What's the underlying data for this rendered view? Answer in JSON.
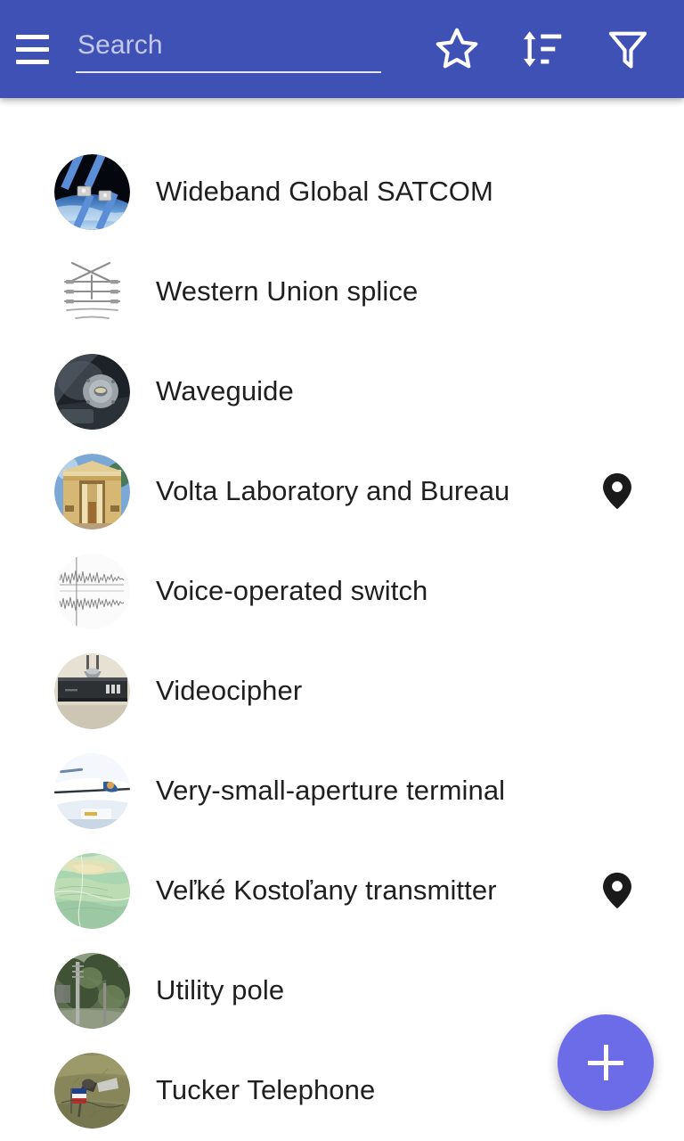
{
  "toolbar": {
    "menu_icon": "hamburger-menu-icon",
    "search": {
      "placeholder": "Search",
      "value": ""
    },
    "actions": [
      {
        "name": "favorites",
        "icon": "star-outline-icon",
        "label": "Favorites"
      },
      {
        "name": "sort",
        "icon": "sort-icon",
        "label": "Sort"
      },
      {
        "name": "filter",
        "icon": "filter-funnel-icon",
        "label": "Filter"
      }
    ],
    "background_color": "#3f51b5"
  },
  "list": {
    "items": [
      {
        "label": "Wideband Global SATCOM",
        "thumb": "satellite-over-earth",
        "has_location": false
      },
      {
        "label": "Western Union splice",
        "thumb": "wire-splice-diagram",
        "has_location": false
      },
      {
        "label": "Waveguide",
        "thumb": "waveguide-flange-photo",
        "has_location": false
      },
      {
        "label": "Volta Laboratory and Bureau",
        "thumb": "neoclassical-building",
        "has_location": true
      },
      {
        "label": "Voice-operated switch",
        "thumb": "audio-waveform",
        "has_location": false
      },
      {
        "label": "Videocipher",
        "thumb": "set-top-box",
        "has_location": false
      },
      {
        "label": "Very-small-aperture terminal",
        "thumb": "white-aircraft-dish",
        "has_location": false
      },
      {
        "label": "Veľké Kostoľany transmitter",
        "thumb": "green-topographic-map",
        "has_location": true
      },
      {
        "label": "Utility pole",
        "thumb": "utility-pole-trees",
        "has_location": false
      },
      {
        "label": "Tucker Telephone",
        "thumb": "field-equipment-flag",
        "has_location": false
      }
    ]
  },
  "fab": {
    "label": "+",
    "icon": "plus-icon",
    "color": "#6c6ce8"
  }
}
